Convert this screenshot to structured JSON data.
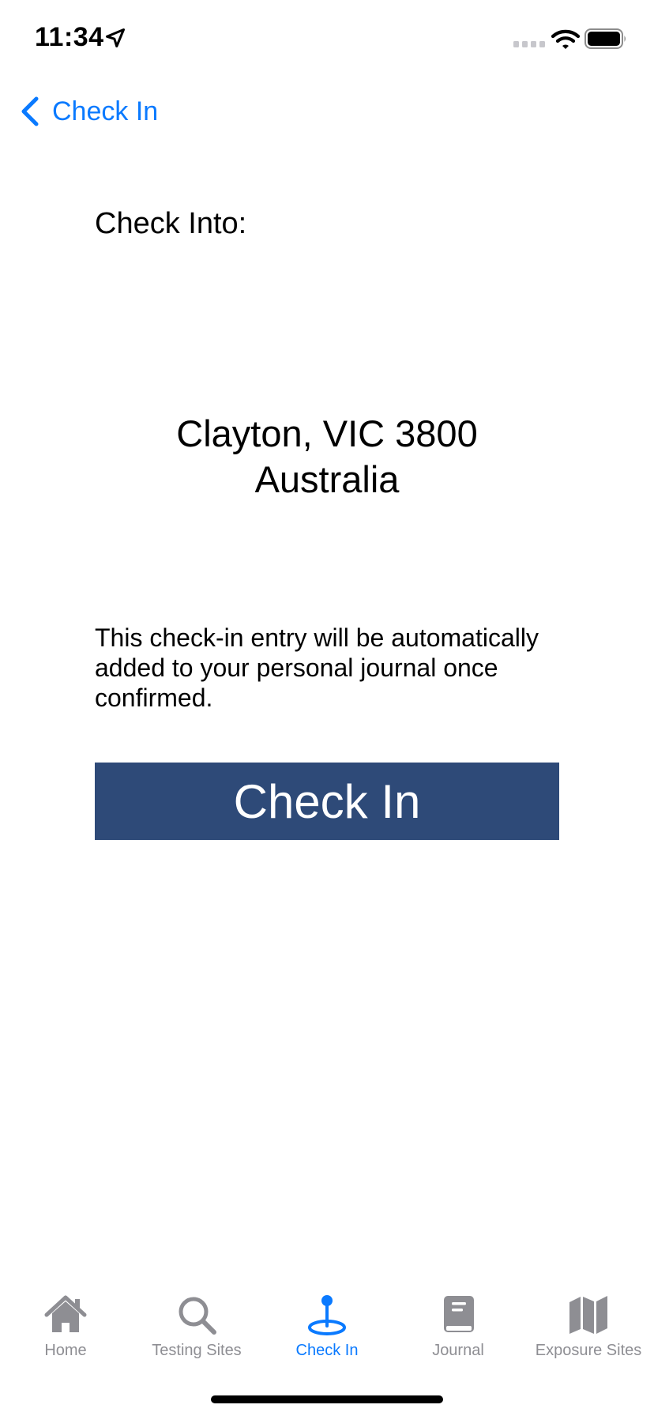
{
  "status_bar": {
    "time": "11:34",
    "icons": [
      "location-arrow-icon",
      "cellular-signal-icon",
      "wifi-icon",
      "battery-icon"
    ]
  },
  "nav": {
    "back_label": "Check In",
    "back_icon": "chevron-left-icon"
  },
  "content": {
    "check_into_label": "Check Into:",
    "address_line1": "Clayton, VIC 3800",
    "address_line2": "Australia",
    "info_text": "This check-in entry will be automatically added to your personal journal once confirmed.",
    "check_in_button": "Check In"
  },
  "tab_bar": {
    "tabs": [
      {
        "label": "Home",
        "icon": "house-icon",
        "active": false
      },
      {
        "label": "Testing Sites",
        "icon": "magnifying-glass-icon",
        "active": false
      },
      {
        "label": "Check In",
        "icon": "map-pin-icon",
        "active": true
      },
      {
        "label": "Journal",
        "icon": "book-icon",
        "active": false
      },
      {
        "label": "Exposure Sites",
        "icon": "map-icon",
        "active": false
      }
    ]
  },
  "colors": {
    "accent": "#0a7aff",
    "button_bg": "#2e4a78",
    "inactive_tab": "#8e8e93"
  }
}
